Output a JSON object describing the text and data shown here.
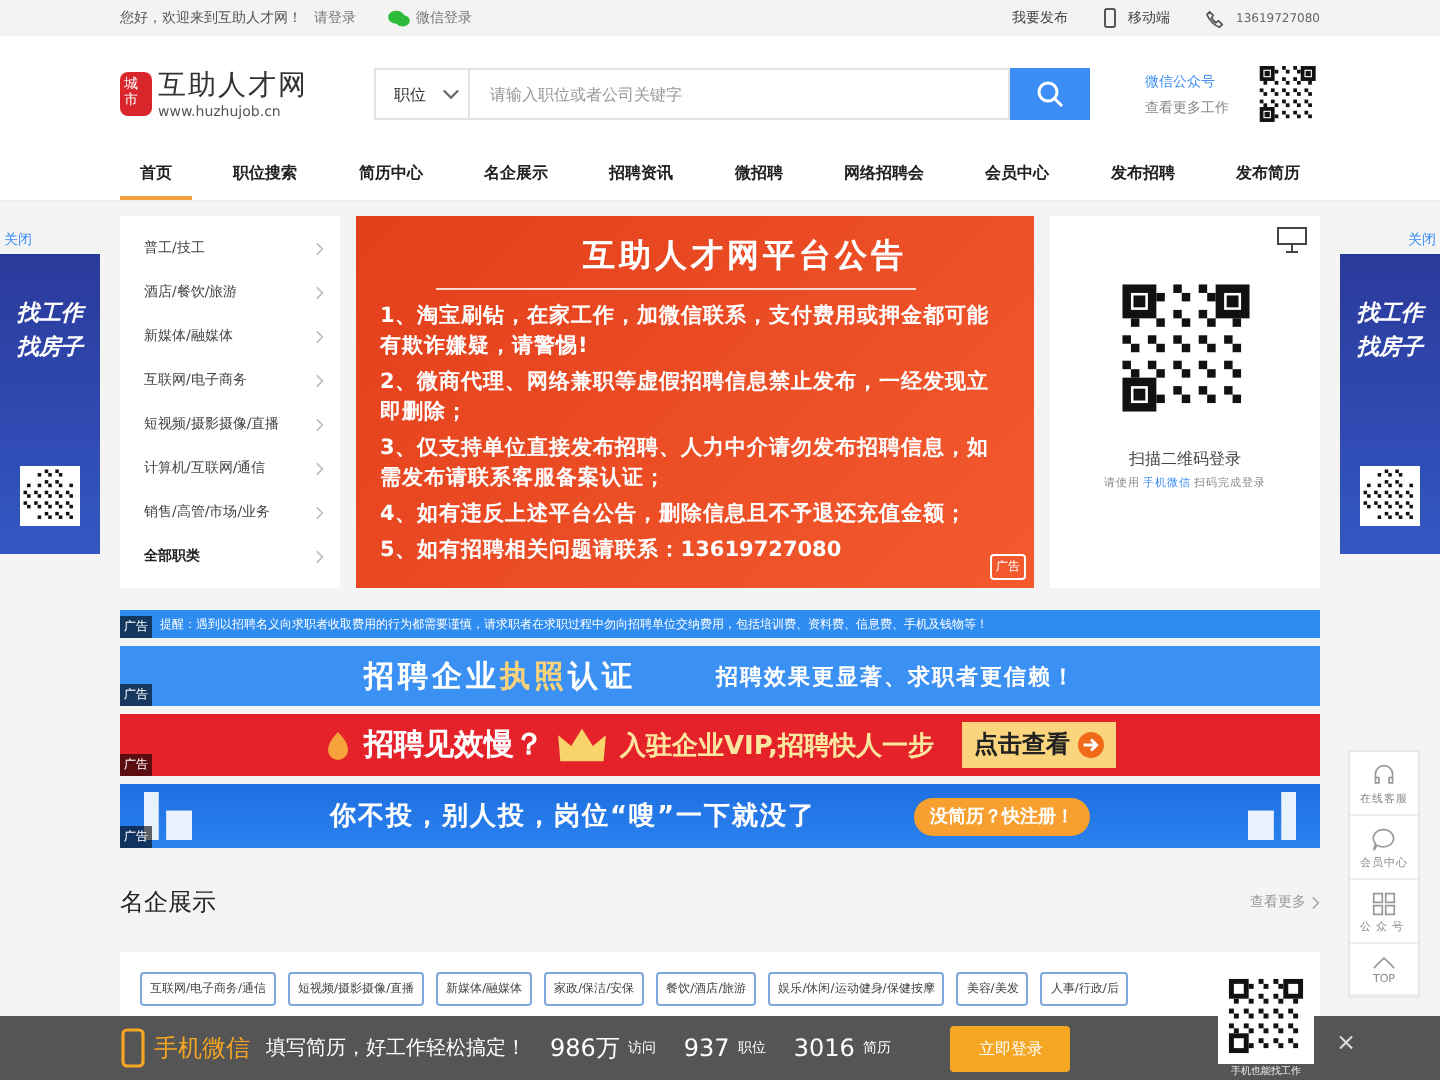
{
  "top_bar": {
    "greeting": "您好，欢迎来到互助人才网！",
    "login_link": "请登录",
    "wechat_login": "微信登录",
    "publish": "我要发布",
    "mobile": "移动端",
    "phone": "13619727080"
  },
  "header": {
    "logo_seal": "城市",
    "logo_title": "互助人才网",
    "logo_url": "www.huzhujob.cn",
    "search": {
      "category": "职位",
      "placeholder": "请输入职位或者公司关键字"
    },
    "wechat": {
      "title": "微信公众号",
      "subtitle": "查看更多工作"
    }
  },
  "nav": [
    {
      "label": "首页",
      "selected": true
    },
    {
      "label": "职位搜索",
      "selected": false
    },
    {
      "label": "简历中心",
      "selected": false
    },
    {
      "label": "名企展示",
      "selected": false
    },
    {
      "label": "招聘资讯",
      "selected": false
    },
    {
      "label": "微招聘",
      "selected": false
    },
    {
      "label": "网络招聘会",
      "selected": false
    },
    {
      "label": "会员中心",
      "selected": false
    },
    {
      "label": "发布招聘",
      "selected": false
    },
    {
      "label": "发布简历",
      "selected": false
    }
  ],
  "side_ads": [
    {
      "close": "关闭",
      "lines": [
        "找工作",
        "找房子"
      ]
    },
    {
      "close": "关闭",
      "lines": [
        "找工作",
        "找房子"
      ]
    }
  ],
  "categories": [
    {
      "label": "普工/技工",
      "kind": "category"
    },
    {
      "label": "酒店/餐饮/旅游",
      "kind": "category"
    },
    {
      "label": "新媒体/融媒体",
      "kind": "category"
    },
    {
      "label": "互联网/电子商务",
      "kind": "category"
    },
    {
      "label": "短视频/摄影摄像/直播",
      "kind": "category"
    },
    {
      "label": "计算机/互联网/通信",
      "kind": "category"
    },
    {
      "label": "销售/高管/市场/业务",
      "kind": "category"
    },
    {
      "label": "全部职类",
      "kind": "all"
    }
  ],
  "announcement": {
    "title": "互助人才网平台公告",
    "items": [
      "1、淘宝刷钻，在家工作，加微信联系，支付费用或押金都可能有欺诈嫌疑，请警惕!",
      "2、微商代理、网络兼职等虚假招聘信息禁止发布，一经发现立即删除；",
      "3、仅支持单位直接发布招聘、人力中介请勿发布招聘信息，如需发布请联系客服备案认证；",
      "4、如有违反上述平台公告，删除信息且不予退还充值金额；",
      "5、如有招聘相关问题请联系：13619727080"
    ],
    "ad_tag": "广告"
  },
  "qr_login": {
    "title": "扫描二维码登录",
    "hint_before": "请使用",
    "hint_link": "手机微信",
    "hint_after": "扫码完成登录"
  },
  "banners": [
    {
      "kind": "notice",
      "ad_tag": "广告",
      "text": "提醒：遇到以招聘名义向求职者收取费用的行为都需要谨慎，请求职者在求职过程中勿向招聘单位交纳费用，包括培训费、资料费、信息费、手机及钱物等！"
    },
    {
      "kind": "cert",
      "ad_tag": "广告",
      "parts": [
        "招聘企业",
        "执照",
        "认证"
      ],
      "slogan": "招聘效果更显著、求职者更信赖！"
    },
    {
      "kind": "vip",
      "ad_tag": "广告",
      "parts": [
        "招聘见效慢？",
        "入驻企业VIP,招聘快人一步"
      ],
      "action": "点击查看"
    },
    {
      "kind": "post",
      "ad_tag": "广告",
      "parts": [
        "你不投，别人投，岗位“嗖”一下就没了"
      ],
      "action": "没简历？快注册！"
    }
  ],
  "section": {
    "title": "名企展示",
    "more": "查看更多",
    "tags": [
      "互联网/电子商务/通信",
      "短视频/摄影摄像/直播",
      "新媒体/融媒体",
      "家政/保洁/安保",
      "餐饮/酒店/旅游",
      "娱乐/休闲/运动健身/保健按摩",
      "美容/美发",
      "人事/行政/后"
    ]
  },
  "float_toolbar": [
    {
      "kind": "service",
      "label": "在线客服"
    },
    {
      "kind": "member",
      "label": "会员中心"
    },
    {
      "kind": "qr",
      "label": "公众号"
    },
    {
      "kind": "top",
      "label": "TOP"
    }
  ],
  "bottom_bar": {
    "brand": "手机微信",
    "slogan": "填写简历，好工作轻松搞定！",
    "stats": [
      {
        "value": "986万",
        "label": "访问"
      },
      {
        "value": "937",
        "label": "职位"
      },
      {
        "value": "3016",
        "label": "简历"
      }
    ],
    "button": "立即登录",
    "qr_caption": "手机也能找工作",
    "close": "×"
  }
}
